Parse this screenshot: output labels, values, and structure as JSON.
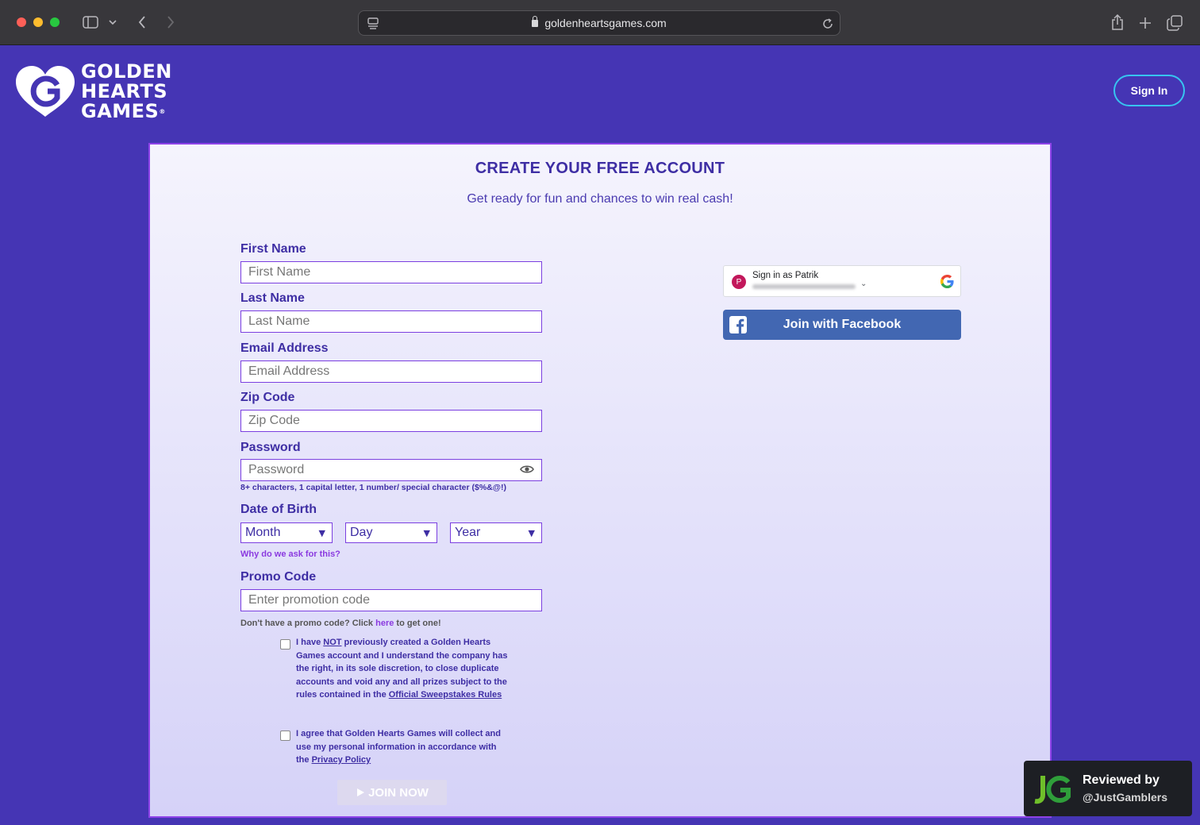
{
  "browser": {
    "url": "goldenheartsgames.com",
    "icons": [
      "sidebar-icon",
      "chevron-down-icon",
      "back-icon",
      "forward-icon",
      "reader-icon",
      "lock-icon",
      "reload-icon",
      "share-icon",
      "new-tab-icon",
      "tabs-icon"
    ]
  },
  "header": {
    "logo_lines": [
      "GOLDEN",
      "HEARTS",
      "GAMES"
    ],
    "logo_mark": "®",
    "signin_label": "Sign In"
  },
  "card": {
    "title": "CREATE YOUR FREE ACCOUNT",
    "subtitle": "Get ready for fun and chances to win real cash!"
  },
  "form": {
    "first_name": {
      "label": "First Name",
      "placeholder": "First Name"
    },
    "last_name": {
      "label": "Last Name",
      "placeholder": "Last Name"
    },
    "email": {
      "label": "Email Address",
      "placeholder": "Email Address"
    },
    "zip": {
      "label": "Zip Code",
      "placeholder": "Zip Code"
    },
    "password": {
      "label": "Password",
      "placeholder": "Password",
      "hint": "8+ characters, 1 capital letter, 1 number/ special character ($%&@!)"
    },
    "dob": {
      "label": "Date of Birth",
      "month": "Month",
      "day": "Day",
      "year": "Year",
      "why_link": "Why do we ask for this?"
    },
    "promo": {
      "label": "Promo Code",
      "placeholder": "Enter promotion code",
      "note_prefix": "Don't have a promo code? Click",
      "note_link": "here",
      "note_suffix": "to get one!"
    },
    "consent1": {
      "part1": "I have",
      "not": "NOT",
      "part2": "previously created a Golden Hearts Games account and I understand the company has the right, in its sole discretion, to close duplicate accounts and void any and all prizes subject to the rules contained in the",
      "link": "Official Sweepstakes Rules"
    },
    "consent2": {
      "part1": "I agree that Golden Hearts Games will collect and use my personal information in accordance with the",
      "link": "Privacy Policy"
    },
    "join_label": "JOIN NOW"
  },
  "social": {
    "google_name": "Sign in as Patrik",
    "google_avatar": "P",
    "facebook_label": "Join with Facebook"
  },
  "badge": {
    "line1": "Reviewed by",
    "line2": "@JustGamblers"
  },
  "colors": {
    "page_bg": "#4535b4",
    "accent": "#3e2ea4",
    "input_border": "#7b3fe0",
    "signin_border": "#37c4f0",
    "facebook": "#4267b2"
  }
}
